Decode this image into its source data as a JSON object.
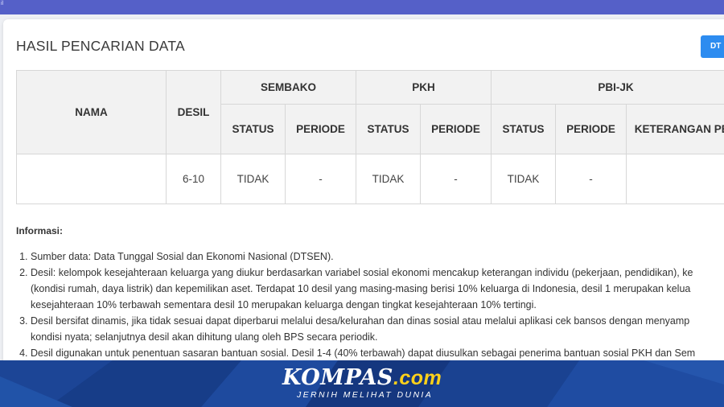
{
  "topbar": {
    "corner_text": "il"
  },
  "page": {
    "title": "HASIL PENCARIAN DATA",
    "export_button": "DT"
  },
  "table": {
    "headers": {
      "nama": "NAMA",
      "desil": "DESIL",
      "sembako": "SEMBAKO",
      "pkh": "PKH",
      "pbi": "PBI-JK",
      "status": "STATUS",
      "periode": "PERIODE",
      "keterangan": "KETERANGAN PBI"
    },
    "row": {
      "nama": "",
      "desil": "6-10",
      "sembako_status": "TIDAK",
      "sembako_periode": "-",
      "pkh_status": "TIDAK",
      "pkh_periode": "-",
      "pbi_status": "TIDAK",
      "pbi_periode": "-",
      "keterangan": ""
    }
  },
  "info": {
    "title": "Informasi:",
    "items": [
      {
        "line1": "Sumber data: Data Tunggal Sosial dan Ekonomi Nasional (DTSEN).",
        "line2": "",
        "line3": ""
      },
      {
        "line1": "Desil: kelompok kesejahteraan keluarga yang diukur berdasarkan variabel sosial ekonomi mencakup keterangan individu (pekerjaan, pendidikan), ke",
        "line2": "(kondisi rumah, daya listrik) dan kepemilikan aset. Terdapat 10 desil yang masing-masing berisi 10% keluarga di Indonesia, desil 1 merupakan kelua",
        "line3": "kesejahteraan 10% terbawah sementara desil 10 merupakan keluarga dengan tingkat kesejahteraan 10% tertingi."
      },
      {
        "line1": "Desil bersifat dinamis, jika tidak sesuai dapat diperbarui melalui desa/kelurahan dan dinas sosial atau melalui aplikasi cek bansos dengan menyamp",
        "line2": "kondisi nyata; selanjutnya desil akan dihitung ulang oleh BPS secara periodik.",
        "line3": ""
      },
      {
        "line1": "Desil digunakan untuk penentuan sasaran bantuan sosial. Desil 1-4 (40% terbawah) dapat diusulkan sebagai penerima bantuan sosial PKH dan Sem",
        "line2": "",
        "line3": ""
      }
    ]
  },
  "watermark": {
    "brand": "KOMPAS",
    "tld": ".com",
    "tagline": "JERNIH MELIHAT DUNIA"
  },
  "colors": {
    "topbar": "#5560c8",
    "button": "#2d8cf0",
    "footer": "#15377f",
    "tld": "#ffd11a"
  }
}
